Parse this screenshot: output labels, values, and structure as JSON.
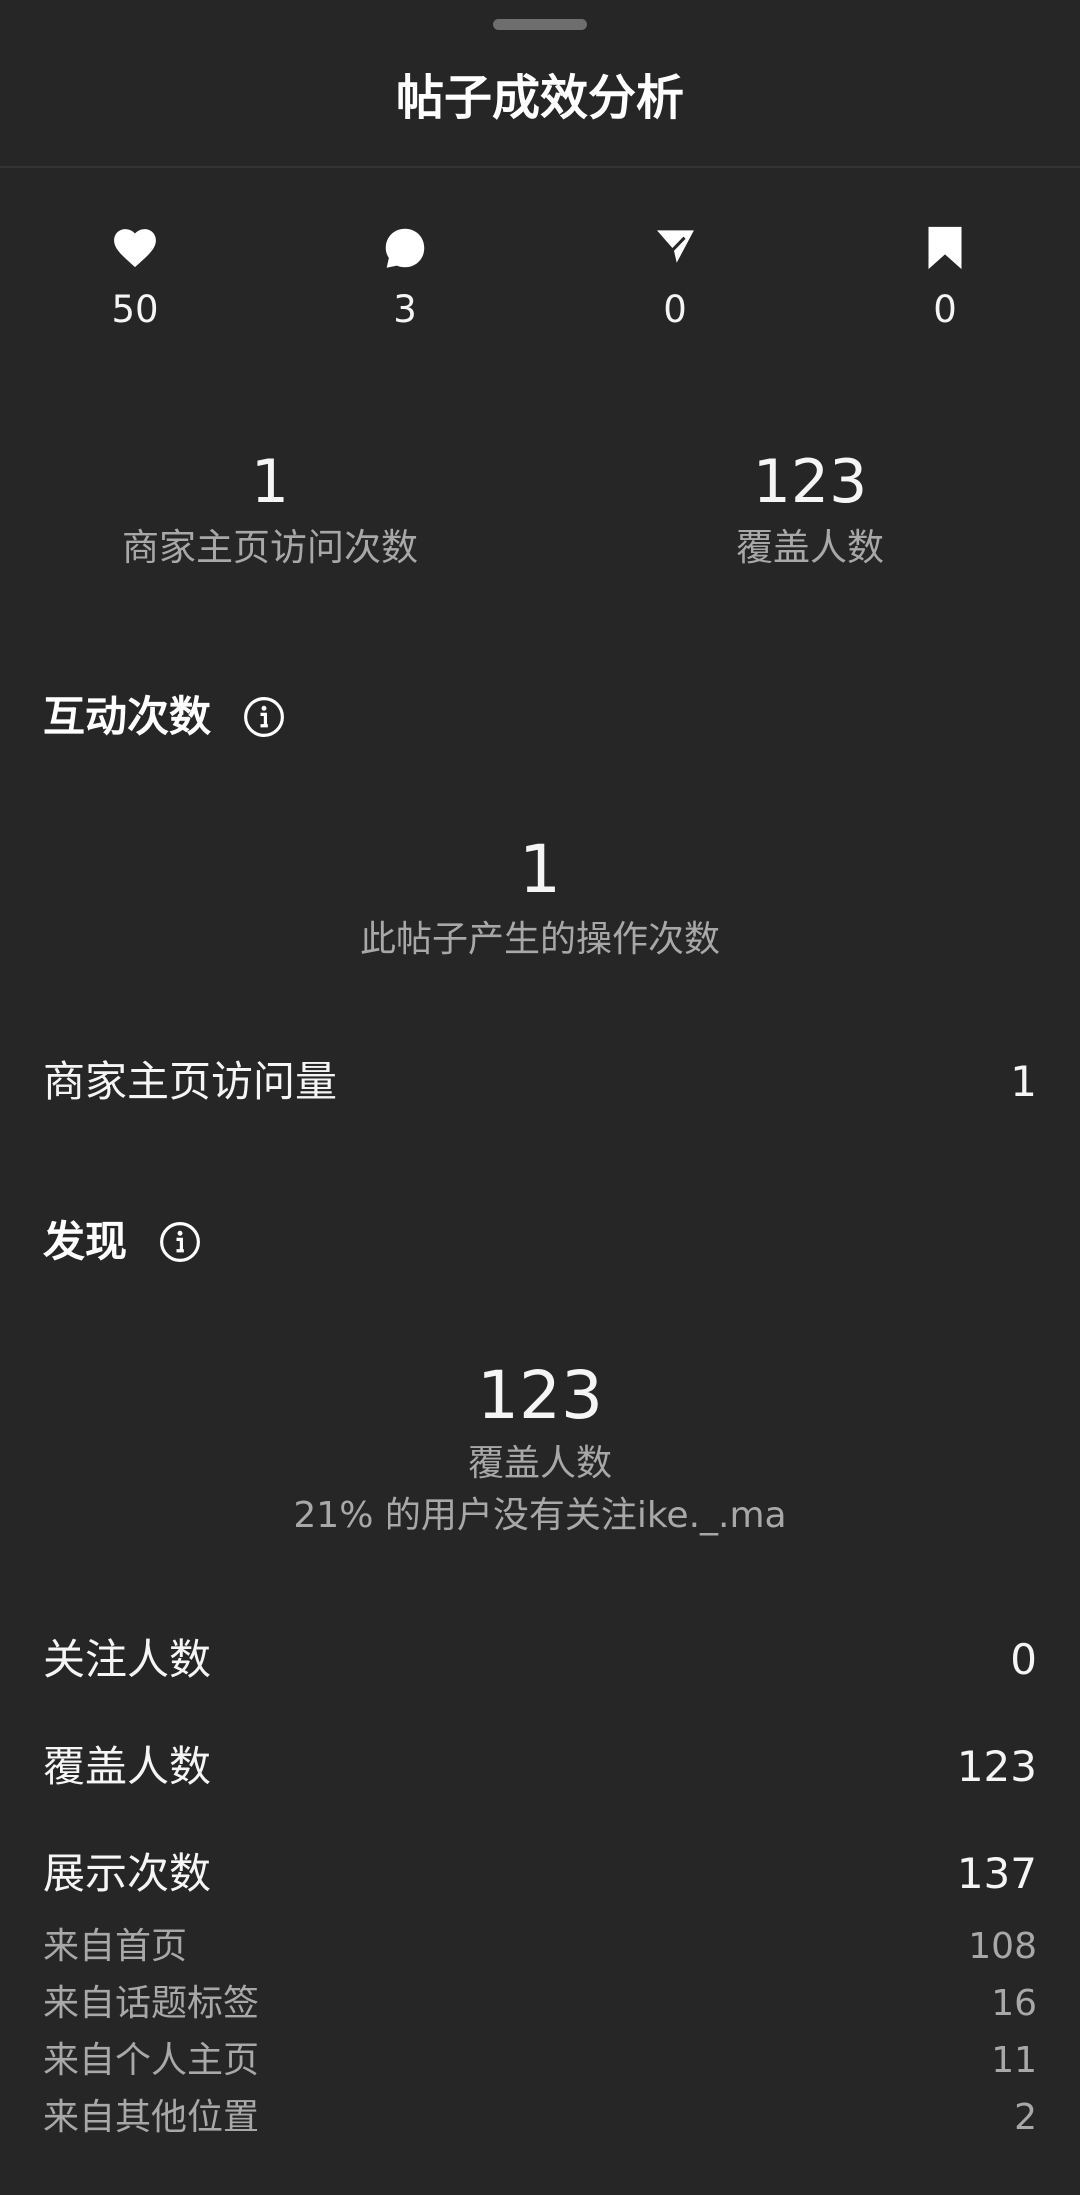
{
  "header": {
    "title": "帖子成效分析"
  },
  "stats": [
    {
      "icon": "heart-icon",
      "value": "50"
    },
    {
      "icon": "comment-icon",
      "value": "3"
    },
    {
      "icon": "share-icon",
      "value": "0"
    },
    {
      "icon": "bookmark-icon",
      "value": "0"
    }
  ],
  "summary": {
    "profile_visits": {
      "value": "1",
      "label": "商家主页访问次数"
    },
    "reach": {
      "value": "123",
      "label": "覆盖人数"
    }
  },
  "interactions": {
    "title": "互动次数",
    "value": "1",
    "label": "此帖子产生的操作次数",
    "rows": [
      {
        "label": "商家主页访问量",
        "value": "1"
      }
    ]
  },
  "discovery": {
    "title": "发现",
    "value": "123",
    "label": "覆盖人数",
    "note": "21% 的用户没有关注ike._.ma",
    "rows": [
      {
        "label": "关注人数",
        "value": "0"
      },
      {
        "label": "覆盖人数",
        "value": "123"
      },
      {
        "label": "展示次数",
        "value": "137"
      }
    ],
    "impression_sources": [
      {
        "label": "来自首页",
        "value": "108"
      },
      {
        "label": "来自话题标签",
        "value": "16"
      },
      {
        "label": "来自个人主页",
        "value": "11"
      },
      {
        "label": "来自其他位置",
        "value": "2"
      }
    ]
  },
  "colors": {
    "background": "#262626",
    "primary_text": "#f5f5f5",
    "secondary_text": "#a8a8a8"
  }
}
